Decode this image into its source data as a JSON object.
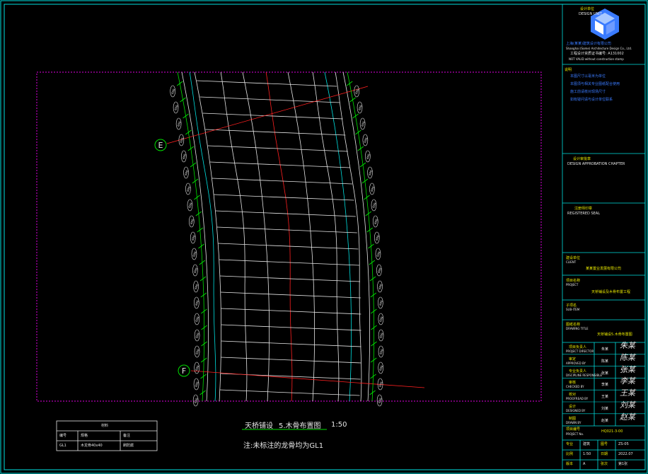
{
  "drawing": {
    "title_left": "天桥铺设",
    "title_right": "5.木骨布置图",
    "scale": "1:50",
    "note": "注:未标注的龙骨均为GL1",
    "axis_labels": [
      "E",
      "F"
    ],
    "dimension_labels": [
      "600",
      "600",
      "600",
      "600",
      "600",
      "600",
      "600",
      "600",
      "600",
      "600",
      "600",
      "600",
      "600",
      "600",
      "600",
      "600",
      "600",
      "600",
      "600",
      "600",
      "600",
      "600",
      "600",
      "600"
    ]
  },
  "material_table": {
    "header": "材料",
    "columns": [
      "编号",
      "规格",
      "备注"
    ],
    "row": [
      "GL1",
      "木龙骨40x40",
      "刷防腐"
    ]
  },
  "title_block": {
    "unit_label": "设计单位",
    "unit_label_en": "DESIGN UNIT",
    "company": "上海(某某)建筑设计有限公司",
    "company_en": "Shanghai (Some) Architecture Design Co., Ltd.",
    "license": "工程设计资质证书编号: A131002",
    "stamp_note": "NOT VALID without construction stamp",
    "notes_label": "说明",
    "notes": [
      "本图尺寸以毫米为单位",
      "本图须与相关专业图纸配合使用",
      "施工前请核对现场尺寸",
      "如有疑问请与设计单位联系"
    ],
    "approval_label": "设计审批章",
    "approval_en": "DESIGN APPROBATION CHAPTER",
    "seal_label": "注册师印章",
    "seal_en": "REGISTERED SEAL",
    "client_label": "建设单位",
    "client_en": "CLIENT",
    "client": "某某置业发展有限公司",
    "project_label": "项目名称",
    "project_en": "PROJECT",
    "project": "天桥铺设及木骨布置工程",
    "subitem_label": "子项名",
    "subitem_en": "SUB-ITEM",
    "drawing_name_label": "图纸名称",
    "drawing_name_en": "DRAWING TITLE",
    "drawing_name": "天桥铺设5.木骨布置图",
    "sign_rows": [
      {
        "label": "项目负责人",
        "en": "PROJECT DIRECTOR",
        "name": "朱某"
      },
      {
        "label": "审定",
        "en": "APPROVED BY",
        "name": "陈某"
      },
      {
        "label": "专业负责人",
        "en": "DISCIPLINE RESPONSIBLE",
        "name": "张某"
      },
      {
        "label": "审核",
        "en": "CHECKED BY",
        "name": "李某"
      },
      {
        "label": "校对",
        "en": "PROOFREAD BY",
        "name": "王某"
      },
      {
        "label": "设计",
        "en": "DESIGNED BY",
        "name": "刘某"
      },
      {
        "label": "制图",
        "en": "DRAWN BY",
        "name": "赵某"
      }
    ],
    "project_no_label": "项目编号",
    "project_no_en": "PROJECT No.",
    "project_no": "HQ021-3-00",
    "bottom_rows": [
      [
        "专业",
        "建筑",
        "图号",
        "ZS-05"
      ],
      [
        "比例",
        "1:50",
        "日期",
        "2022.07"
      ],
      [
        "版本",
        "A",
        "张次",
        "第1张"
      ]
    ]
  },
  "colors": {
    "frame": "#00e0e0",
    "viewport": "#e000e0",
    "grid": "#e6e6e6",
    "red_line": "#ff2020",
    "dim": "#00e000",
    "highlight": "#3a7bff",
    "logo": "#3a7bff"
  }
}
